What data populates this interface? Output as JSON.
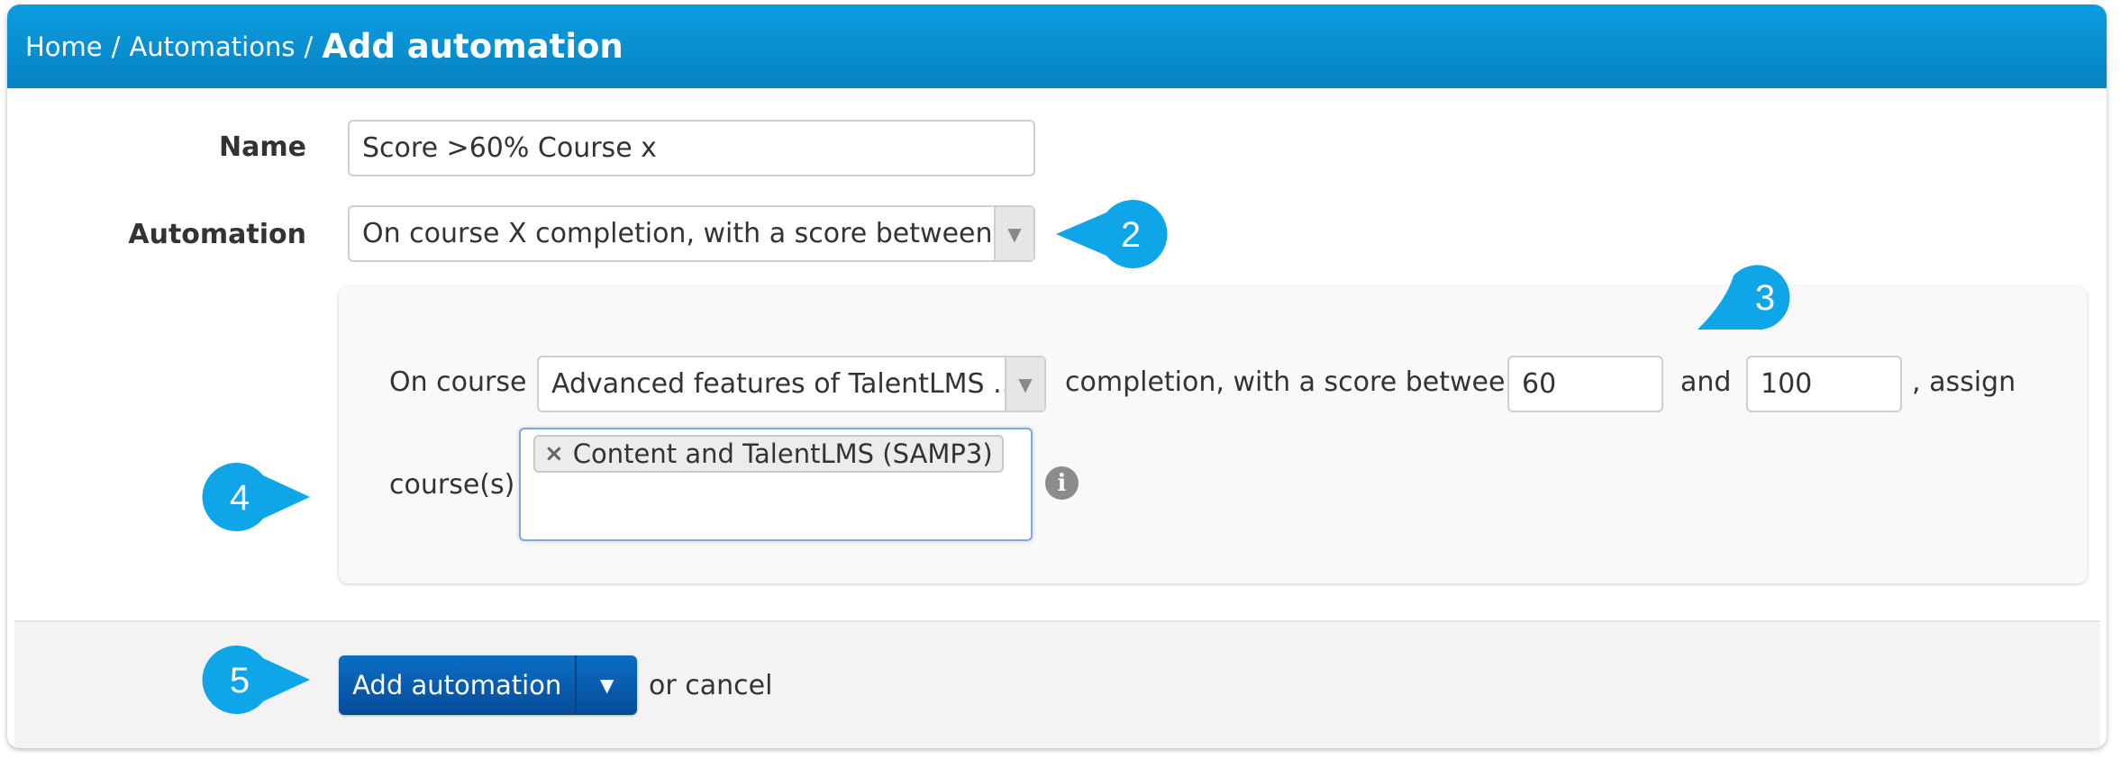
{
  "breadcrumb": {
    "home": "Home",
    "separator": "/",
    "automations": "Automations",
    "current": "Add automation"
  },
  "form": {
    "name_label": "Name",
    "name_value": "Score >60% Course x",
    "automation_label": "Automation",
    "automation_value": "On course X completion, with a score between ..."
  },
  "rule": {
    "on_course": "On course",
    "course_value": "Advanced features of TalentLMS ...",
    "completion_text": "completion, with a score between",
    "min_score": "60",
    "and": "and",
    "max_score": "100",
    "assign": ", assign",
    "courses_label": "course(s)",
    "selected_courses": [
      "Content and TalentLMS (SAMP3)"
    ],
    "tag_remove": "×",
    "info_icon": "i"
  },
  "footer": {
    "submit_label": "Add automation",
    "or_cancel": "or cancel"
  },
  "callouts": {
    "c2": "2",
    "c3": "3",
    "c4": "4",
    "c5": "5"
  },
  "colors": {
    "header": "#0b9de0",
    "callout": "#0ea5e9",
    "button": "#0760b0"
  },
  "icons": {
    "select_arrow": "caret-down-icon",
    "info": "info-icon",
    "remove": "close-icon"
  }
}
